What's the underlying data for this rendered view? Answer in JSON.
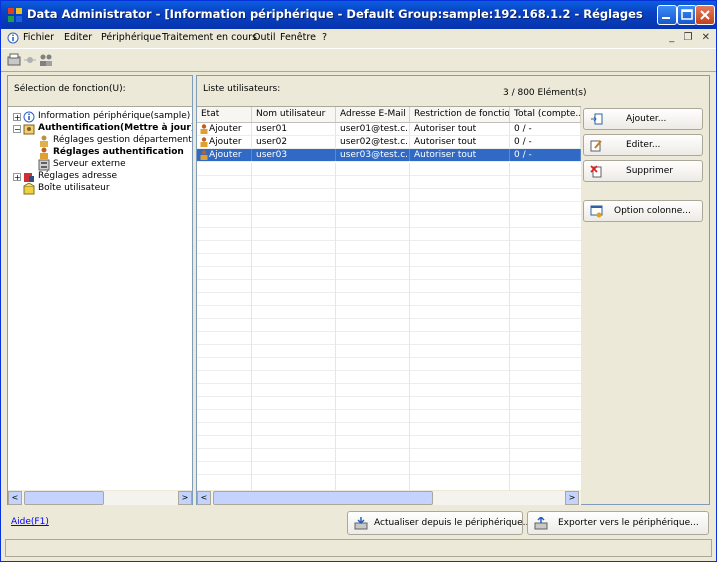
{
  "window": {
    "title": "Data Administrator - [Information périphérique - Default Group:sample:192.168.1.2 - Réglages authentification utilis..."
  },
  "menu": {
    "items": [
      "Fichier",
      "Editer",
      "Périphérique",
      "Traitement en cours",
      "Outil",
      "Fenêtre",
      "?"
    ]
  },
  "left_panel": {
    "label": "Sélection de fonction(U):",
    "tree": [
      {
        "label": "Information périphérique(sample)",
        "icon": "device-info-icon"
      },
      {
        "label": "Authentification(Mettre à jour)",
        "icon": "auth-icon"
      },
      {
        "label": "Réglages gestion département",
        "icon": "dept-icon"
      },
      {
        "label": "Réglages authentification",
        "icon": "user-icon"
      },
      {
        "label": "Serveur externe",
        "icon": "server-icon"
      },
      {
        "label": "Réglages adresse",
        "icon": "address-icon"
      },
      {
        "label": "Boîte utilisateur",
        "icon": "box-icon"
      }
    ]
  },
  "right_panel": {
    "label": "Liste utilisateurs:",
    "count": "3 / 800 Elément(s)",
    "columns": [
      "Etat",
      "Nom utilisateur",
      "Adresse E-Mail",
      "Restriction de fonction",
      "Total (compte..."
    ],
    "rows": [
      {
        "etat": "Ajouter",
        "name": "user01",
        "email": "user01@test.c...",
        "restriction": "Autoriser tout",
        "total": "0 / -"
      },
      {
        "etat": "Ajouter",
        "name": "user02",
        "email": "user02@test.c...",
        "restriction": "Autoriser tout",
        "total": "0 / -"
      },
      {
        "etat": "Ajouter",
        "name": "user03",
        "email": "user03@test.c...",
        "restriction": "Autoriser tout",
        "total": "0 / -"
      }
    ],
    "selected_row": 2,
    "buttons": {
      "add": "Ajouter...",
      "edit": "Editer...",
      "delete": "Supprimer",
      "column_option": "Option colonne..."
    }
  },
  "bottom": {
    "help_link": "Aide(F1)",
    "refresh_button": "Actualiser depuis le périphérique...",
    "export_button": "Exporter vers le périphérique..."
  },
  "colors": {
    "titlebar": "#0842C2",
    "selection": "#316AC5",
    "window_bg": "#ECE9D8"
  }
}
